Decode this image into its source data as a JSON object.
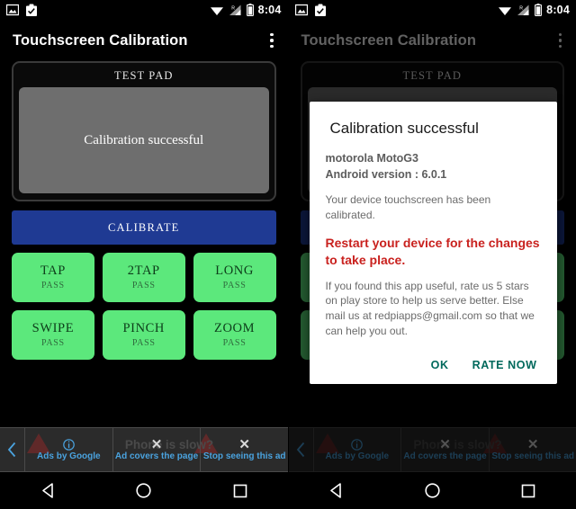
{
  "status_bar": {
    "time": "8:04",
    "icons": [
      "image-icon",
      "clipboard-check-icon",
      "wifi-icon",
      "signal-roaming-icon",
      "battery-icon"
    ],
    "roaming_label": "R"
  },
  "app": {
    "title": "Touchscreen Calibration",
    "overflow_menu": "overflow-menu"
  },
  "test_pad": {
    "label": "TEST PAD",
    "pad_text": "Calibration successful"
  },
  "calibrate_button": {
    "label": "CALIBRATE"
  },
  "gesture_tests": [
    {
      "name": "TAP",
      "status": "PASS"
    },
    {
      "name": "2TAP",
      "status": "PASS"
    },
    {
      "name": "LONG",
      "status": "PASS"
    },
    {
      "name": "SWIPE",
      "status": "PASS"
    },
    {
      "name": "PINCH",
      "status": "PASS"
    },
    {
      "name": "ZOOM",
      "status": "PASS"
    }
  ],
  "ad_bar": {
    "back_icon": "chevron-left-icon",
    "ghost_text": "Phone is slow?",
    "ads_by_google": "Ads by Google",
    "ad_covers": "Ad covers the page",
    "stop_seeing": "Stop seeing this ad"
  },
  "nav_bar": {
    "back": "back-triangle",
    "home": "home-circle",
    "recents": "recents-square"
  },
  "dialog": {
    "title": "Calibration successful",
    "device": "motorola MotoG3",
    "android_version": "Android version : 6.0.1",
    "body1": "Your device touchscreen has been calibrated.",
    "warning": "Restart your device for the changes to take place.",
    "body2": "If you found this app useful, rate us 5 stars on play store to help us serve better. Else mail us at redpiapps@gmail.com so that we can help you out.",
    "ok_label": "OK",
    "rate_label": "RATE NOW"
  },
  "colors": {
    "accent_blue": "#1f3a93",
    "pass_green": "#5ce87c",
    "warning_red": "#c9211e",
    "dialog_action": "#00695c",
    "ad_link_blue": "#4aa3df"
  }
}
